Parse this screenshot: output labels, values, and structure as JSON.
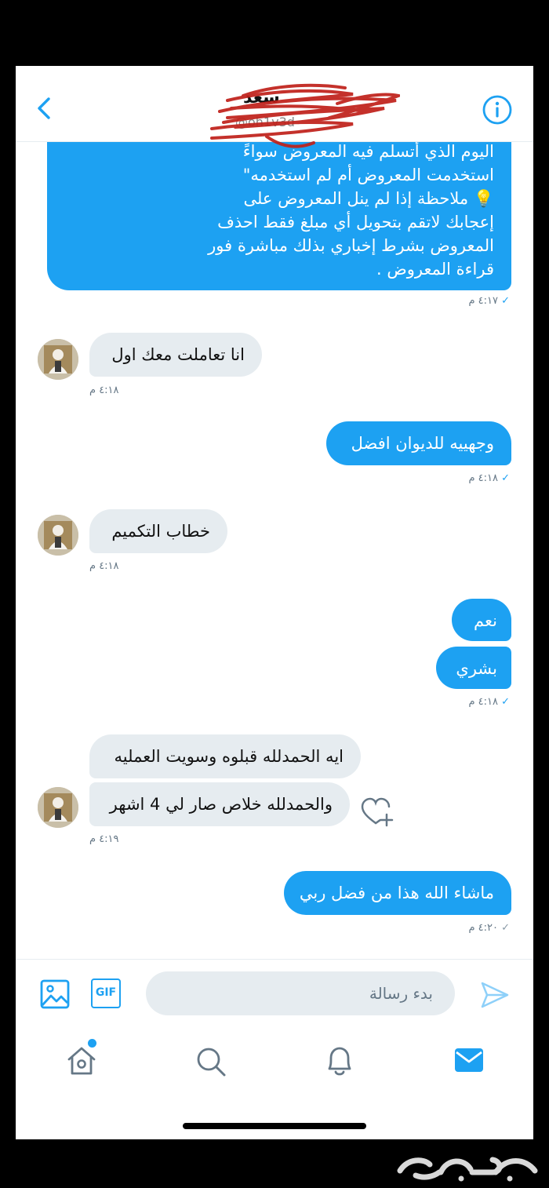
{
  "header": {
    "title": "سعد",
    "handle": "@oh1v3d"
  },
  "messages": {
    "first": {
      "lines": [
        "اليوم الذي أتسلم فيه المعروض سواءً",
        "استخدمت المعروض أم لم استخدمه\"",
        "💡 ملاحظة إذا لم ينل المعروض على",
        "إعجابك لاتقم بتحويل أي مبلغ فقط احذف",
        "المعروض بشرط إخباري بذلك مباشرة فور",
        "قراءة المعروض ."
      ],
      "time": "٤:١٧ م"
    },
    "m2": {
      "text": "انا تعاملت معك اول",
      "time": "٤:١٨ م"
    },
    "m3": {
      "text": "وجهييه للديوان افضل",
      "time": "٤:١٨ م"
    },
    "m4": {
      "text": "خطاب التكميم",
      "time": "٤:١٨ م"
    },
    "m5a": {
      "text": "نعم"
    },
    "m5b": {
      "text": "بشري",
      "time": "٤:١٨ م"
    },
    "m6a": {
      "text": "ايه الحمدلله قبلوه وسويت العمليه"
    },
    "m6b": {
      "text": "والحمدلله خلاص صار لي 4 اشهر",
      "time": "٤:١٩ م"
    },
    "m7": {
      "text": "ماشاء الله هذا من فضل ربي",
      "time": "٤:٢٠ م"
    }
  },
  "composer": {
    "gif_label": "GIF",
    "placeholder": "بدء رسالة"
  },
  "tabs": {
    "home_has_notification": true,
    "active": "messages"
  },
  "watermark": "حراج",
  "colors": {
    "accent": "#1da1f2",
    "incoming_bubble": "#e6ecf0",
    "text": "#111111",
    "muted": "#657786",
    "redaction": "#c0201a"
  },
  "icons": {
    "back": "chevron-left-icon",
    "info": "info-icon",
    "image": "image-icon",
    "gif": "gif-icon",
    "send": "send-icon",
    "home": "home-icon",
    "search": "search-icon",
    "notifications": "bell-icon",
    "messages": "mail-icon",
    "react": "heart-plus-icon"
  }
}
